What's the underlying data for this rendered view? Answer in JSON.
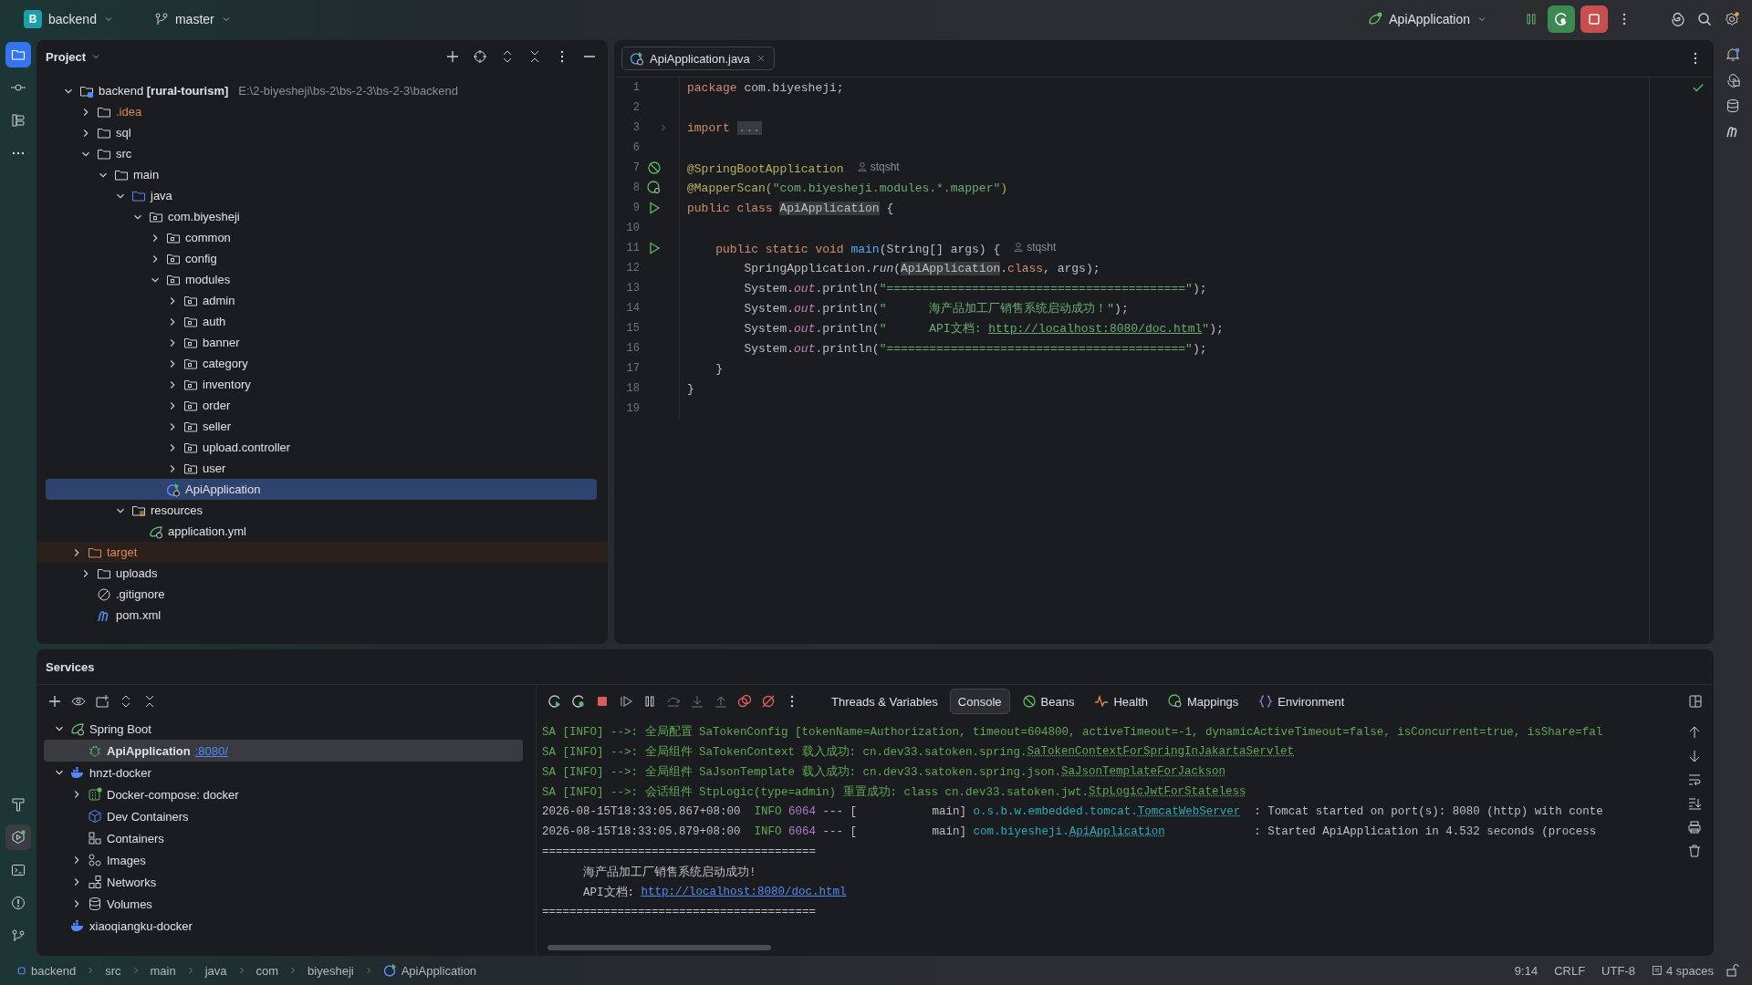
{
  "topbar": {
    "project": {
      "badge": "B",
      "name": "backend"
    },
    "branch": "master",
    "run_config": "ApiApplication"
  },
  "project_panel": {
    "title": "Project",
    "tree": [
      {
        "label": "backend **[rural-tourism]**",
        "path": "E:\\2-biyesheji\\bs-2\\bs-2-3\\bs-2-3\\backend",
        "kind": "module",
        "expanded": true,
        "selected": false,
        "children": [
          {
            "label": ".idea",
            "kind": "ignored-folder",
            "expanded": false,
            "selected": false
          },
          {
            "label": "sql",
            "kind": "folder",
            "expanded": false,
            "selected": false
          },
          {
            "label": "src",
            "kind": "folder",
            "expanded": true,
            "selected": false,
            "children": [
              {
                "label": "main",
                "kind": "folder",
                "expanded": true,
                "selected": false,
                "children": [
                  {
                    "label": "java",
                    "kind": "source-folder",
                    "expanded": true,
                    "selected": false,
                    "children": [
                      {
                        "label": "com.biyesheji",
                        "kind": "package",
                        "expanded": true,
                        "selected": false,
                        "children": [
                          {
                            "label": "common",
                            "kind": "package",
                            "expanded": false,
                            "selected": false
                          },
                          {
                            "label": "config",
                            "kind": "package",
                            "expanded": false,
                            "selected": false
                          },
                          {
                            "label": "modules",
                            "kind": "package",
                            "expanded": true,
                            "selected": false,
                            "children": [
                              {
                                "label": "admin",
                                "kind": "package",
                                "expanded": false,
                                "selected": false
                              },
                              {
                                "label": "auth",
                                "kind": "package",
                                "expanded": false,
                                "selected": false
                              },
                              {
                                "label": "banner",
                                "kind": "package",
                                "expanded": false,
                                "selected": false
                              },
                              {
                                "label": "category",
                                "kind": "package",
                                "expanded": false,
                                "selected": false
                              },
                              {
                                "label": "inventory",
                                "kind": "package",
                                "expanded": false,
                                "selected": false
                              },
                              {
                                "label": "order",
                                "kind": "package",
                                "expanded": false,
                                "selected": false
                              },
                              {
                                "label": "seller",
                                "kind": "package",
                                "expanded": false,
                                "selected": false
                              },
                              {
                                "label": "upload.controller",
                                "kind": "package",
                                "expanded": false,
                                "selected": false
                              },
                              {
                                "label": "user",
                                "kind": "package",
                                "expanded": false,
                                "selected": false
                              }
                            ]
                          },
                          {
                            "label": "ApiApplication",
                            "kind": "class",
                            "selected": true
                          }
                        ]
                      }
                    ]
                  },
                  {
                    "label": "resources",
                    "kind": "resource-folder",
                    "expanded": true,
                    "selected": false,
                    "children": [
                      {
                        "label": "application.yml",
                        "kind": "spring-config",
                        "selected": false
                      }
                    ]
                  }
                ]
              }
            ]
          },
          {
            "label": "target",
            "kind": "excluded-folder",
            "expanded": false,
            "selected": false
          },
          {
            "label": "uploads",
            "kind": "folder",
            "expanded": false,
            "selected": false
          },
          {
            "label": ".gitignore",
            "kind": "ignore",
            "selected": false
          },
          {
            "label": "pom.xml",
            "kind": "maven",
            "selected": false
          }
        ]
      }
    ]
  },
  "editor": {
    "tabs": [
      {
        "label": "ApiApplication.java",
        "selected": true
      }
    ],
    "lines": [
      {
        "number": "1",
        "kind": "plain",
        "tokens": [
          {
            "kind": "keyword",
            "text": "package"
          },
          {
            "kind": "plain",
            "text": " com.biyesheji;"
          }
        ]
      },
      {
        "number": "2",
        "kind": "plain"
      },
      {
        "number": "3",
        "kind": "fold",
        "tokens": [
          {
            "kind": "keyword",
            "text": "import "
          },
          {
            "kind": "fold",
            "text": "..."
          }
        ]
      },
      {
        "number": "6",
        "kind": "plain"
      },
      {
        "number": "7",
        "kind": "bean",
        "tokens": [
          {
            "kind": "annotation",
            "text": "@SpringBootApplication"
          },
          {
            "kind": "author",
            "text": "stqsht"
          }
        ]
      },
      {
        "number": "8",
        "kind": "bean-search",
        "tokens": [
          {
            "kind": "annotation",
            "text": "@MapperScan("
          },
          {
            "kind": "string",
            "text": "\"com.biyesheji.modules.*.mapper\""
          },
          {
            "kind": "annotation",
            "text": ")"
          }
        ]
      },
      {
        "number": "9",
        "kind": "run",
        "tokens": [
          {
            "kind": "keyword",
            "text": "public class "
          },
          {
            "kind": "usage",
            "text": "ApiApplication"
          },
          {
            "kind": "plain",
            "text": " {"
          }
        ]
      },
      {
        "number": "10",
        "kind": "plain"
      },
      {
        "number": "11",
        "kind": "run",
        "tokens": [
          {
            "kind": "keyword",
            "text": "    public static void "
          },
          {
            "kind": "method",
            "text": "main"
          },
          {
            "kind": "plain",
            "text": "(String[] args) {"
          },
          {
            "kind": "author",
            "text": "stqsht"
          }
        ]
      },
      {
        "number": "12",
        "kind": "plain",
        "tokens": [
          {
            "kind": "plain",
            "text": "        SpringApplication."
          },
          {
            "kind": "call",
            "text": "run"
          },
          {
            "kind": "plain",
            "text": "("
          },
          {
            "kind": "usage",
            "text": "ApiApplication"
          },
          {
            "kind": "plain",
            "text": "."
          },
          {
            "kind": "keyword",
            "text": "class"
          },
          {
            "kind": "plain",
            "text": ", args);"
          }
        ]
      },
      {
        "number": "13",
        "kind": "plain",
        "tokens": [
          {
            "kind": "plain",
            "text": "        System."
          },
          {
            "kind": "field",
            "text": "out"
          },
          {
            "kind": "plain",
            "text": ".println("
          },
          {
            "kind": "string",
            "text": "\"==========================================\""
          },
          {
            "kind": "plain",
            "text": ");"
          }
        ]
      },
      {
        "number": "14",
        "kind": "plain",
        "tokens": [
          {
            "kind": "plain",
            "text": "        System."
          },
          {
            "kind": "field",
            "text": "out"
          },
          {
            "kind": "plain",
            "text": ".println("
          },
          {
            "kind": "string",
            "text": "\"      海产品加工厂销售系统启动成功！\""
          },
          {
            "kind": "plain",
            "text": ");"
          }
        ]
      },
      {
        "number": "15",
        "kind": "plain",
        "tokens": [
          {
            "kind": "plain",
            "text": "        System."
          },
          {
            "kind": "field",
            "text": "out"
          },
          {
            "kind": "plain",
            "text": ".println("
          },
          {
            "kind": "string",
            "text": "\"      API文档: "
          },
          {
            "kind": "url",
            "text": "http://localhost:8080/doc.html"
          },
          {
            "kind": "string",
            "text": "\""
          },
          {
            "kind": "plain",
            "text": ");"
          }
        ]
      },
      {
        "number": "16",
        "kind": "plain",
        "tokens": [
          {
            "kind": "plain",
            "text": "        System."
          },
          {
            "kind": "field",
            "text": "out"
          },
          {
            "kind": "plain",
            "text": ".println("
          },
          {
            "kind": "string",
            "text": "\"==========================================\""
          },
          {
            "kind": "plain",
            "text": ");"
          }
        ]
      },
      {
        "number": "17",
        "kind": "plain",
        "tokens": [
          {
            "kind": "plain",
            "text": "    }"
          }
        ]
      },
      {
        "number": "18",
        "kind": "plain",
        "tokens": [
          {
            "kind": "plain",
            "text": "}"
          }
        ]
      },
      {
        "number": "19",
        "kind": "plain"
      }
    ]
  },
  "services": {
    "title": "Services",
    "tree": [
      {
        "label": "Spring Boot",
        "kind": "spring-boot",
        "expanded": true,
        "selected": false,
        "children": [
          {
            "label": "ApiApplication",
            "port": ":8080/",
            "kind": "app",
            "selected": true
          }
        ]
      },
      {
        "label": "hnzt-docker",
        "kind": "docker",
        "expanded": true,
        "selected": false,
        "children": [
          {
            "label": "Docker-compose: docker",
            "kind": "compose",
            "expanded": false,
            "selected": false
          },
          {
            "label": "Dev Containers",
            "kind": "dev-containers",
            "selected": false
          },
          {
            "label": "Containers",
            "kind": "containers",
            "selected": false
          },
          {
            "label": "Images",
            "kind": "images",
            "expanded": false,
            "selected": false
          },
          {
            "label": "Networks",
            "kind": "networks",
            "expanded": false,
            "selected": false
          },
          {
            "label": "Volumes",
            "kind": "volumes",
            "expanded": false,
            "selected": false
          }
        ]
      },
      {
        "label": "xiaoqiangku-docker",
        "kind": "docker",
        "selected": false
      }
    ],
    "tabs": [
      {
        "label": "Threads & Variables",
        "kind": "threads",
        "selected": false
      },
      {
        "label": "Console",
        "kind": "console",
        "selected": true
      },
      {
        "label": "Beans",
        "kind": "beans",
        "selected": false
      },
      {
        "label": "Health",
        "kind": "health",
        "selected": false
      },
      {
        "label": "Mappings",
        "kind": "mappings",
        "selected": false
      },
      {
        "label": "Environment",
        "kind": "environment",
        "selected": false
      }
    ],
    "console": [
      {
        "tokens": [
          {
            "kind": "log",
            "text": "SA [INFO] -->: 全局配置 SaTokenConfig [tokenName=Authorization, timeout=604800, activeTimeout=-1, dynamicActiveTimeout=false, isConcurrent=true, isShare=fal"
          }
        ]
      },
      {
        "tokens": [
          {
            "kind": "log",
            "text": "SA [INFO] -->: 全局组件 SaTokenContext 载入成功: cn.dev33.satoken.spring."
          },
          {
            "kind": "log-link",
            "text": "SaTokenContextForSpringInJakartaServlet"
          }
        ]
      },
      {
        "tokens": [
          {
            "kind": "log",
            "text": "SA [INFO] -->: 全局组件 SaJsonTemplate 载入成功: cn.dev33.satoken.spring.json."
          },
          {
            "kind": "log-link",
            "text": "SaJsonTemplateForJackson"
          }
        ]
      },
      {
        "tokens": [
          {
            "kind": "log",
            "text": "SA [INFO] -->: 会话组件 StpLogic(type=admin) 重置成功: class cn.dev33.satoken.jwt."
          },
          {
            "kind": "log-link",
            "text": "StpLogicJwtForStateless"
          }
        ]
      },
      {
        "tokens": [
          {
            "kind": "plain",
            "text": "2026-08-15T18:33:05.867+08:00  "
          },
          {
            "kind": "level",
            "text": "INFO "
          },
          {
            "kind": "pid",
            "text": "6064"
          },
          {
            "kind": "plain",
            "text": " --- [           main] "
          },
          {
            "kind": "logger",
            "text": "o.s.b.w.embedded.tomcat."
          },
          {
            "kind": "logger-link",
            "text": "TomcatWebServer"
          },
          {
            "kind": "plain",
            "text": "  : Tomcat started on port(s): 8080 (http) with conte"
          }
        ]
      },
      {
        "tokens": [
          {
            "kind": "plain",
            "text": "2026-08-15T18:33:05.879+08:00  "
          },
          {
            "kind": "level",
            "text": "INFO "
          },
          {
            "kind": "pid",
            "text": "6064"
          },
          {
            "kind": "plain",
            "text": " --- [           main] "
          },
          {
            "kind": "logger",
            "text": "com.biyesheji."
          },
          {
            "kind": "logger-link",
            "text": "ApiApplication"
          },
          {
            "kind": "plain",
            "text": "             : Started ApiApplication in 4.532 seconds (process"
          }
        ]
      },
      {
        "tokens": [
          {
            "kind": "plain",
            "text": "========================================"
          }
        ]
      },
      {
        "tokens": [
          {
            "kind": "plain",
            "text": "      海产品加工厂销售系统启动成功!"
          }
        ]
      },
      {
        "tokens": [
          {
            "kind": "plain",
            "text": "      API文档: "
          },
          {
            "kind": "url",
            "text": "http://localhost:8080/doc.html"
          }
        ]
      },
      {
        "tokens": [
          {
            "kind": "plain",
            "text": "========================================"
          }
        ]
      }
    ]
  },
  "status_bar": {
    "breadcrumbs": [
      {
        "label": "backend",
        "kind": "module"
      },
      {
        "label": "src",
        "kind": "plain"
      },
      {
        "label": "main",
        "kind": "plain"
      },
      {
        "label": "java",
        "kind": "plain"
      },
      {
        "label": "com",
        "kind": "plain"
      },
      {
        "label": "biyesheji",
        "kind": "plain"
      },
      {
        "label": "ApiApplication",
        "kind": "class"
      }
    ],
    "cursor": "9:14",
    "line_ending": "CRLF",
    "encoding": "UTF-8",
    "indent": "4 spaces"
  }
}
